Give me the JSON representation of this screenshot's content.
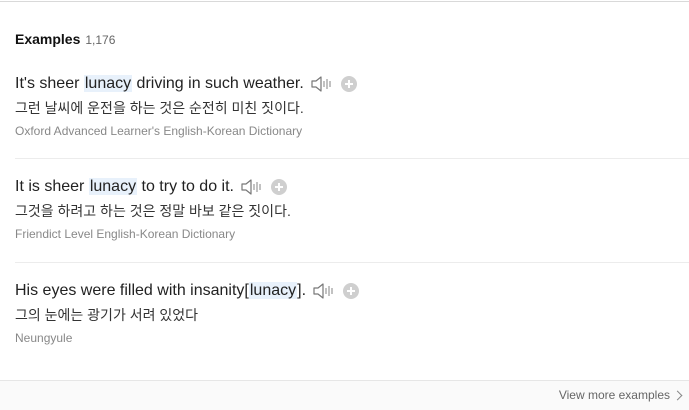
{
  "header": {
    "title": "Examples",
    "count": "1,176"
  },
  "examples": [
    {
      "en_before": "It's sheer ",
      "en_highlight": "lunacy",
      "en_after": " driving in such weather.",
      "ko": "그런 날씨에 운전을 하는 것은 순전히 미친 짓이다.",
      "source": "Oxford Advanced Learner's English-Korean Dictionary"
    },
    {
      "en_before": "It is sheer ",
      "en_highlight": "lunacy",
      "en_after": " to try to do it.",
      "ko": "그것을 하려고 하는 것은 정말 바보 같은 짓이다.",
      "source": "Friendict Level English-Korean Dictionary"
    },
    {
      "en_before": "His eyes were filled with insanity[",
      "en_highlight": "lunacy",
      "en_after": "].",
      "ko": "그의 눈에는 광기가 서려 있었다",
      "source": "Neungyule"
    }
  ],
  "footer": {
    "more_label": "View more examples"
  },
  "icons": {
    "speaker": "speaker-icon",
    "add": "plus-circle-icon",
    "chevron": "chevron-right-icon"
  },
  "colors": {
    "highlight_bg": "#e8f1fb",
    "source_text": "#888888",
    "add_button": "#cfcfcf"
  }
}
